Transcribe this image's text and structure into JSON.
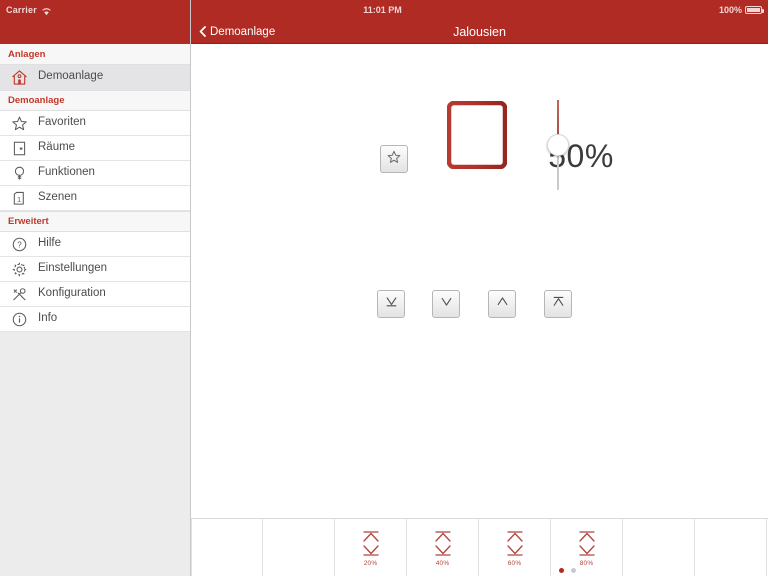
{
  "status_bar": {
    "carrier": "Carrier",
    "wifi_icon": "wifi-icon",
    "time": "11:01 PM",
    "battery_percent": "100%",
    "battery_icon": "battery-full-icon"
  },
  "navbar": {
    "back_icon": "chevron-left-icon",
    "back_label": "Demoanlage",
    "title": "Jalousien"
  },
  "sidebar": {
    "sections": [
      {
        "header": "Anlagen",
        "items": [
          {
            "label": "Demoanlage",
            "icon": "home-icon",
            "selected": true
          }
        ]
      },
      {
        "header": "Demoanlage",
        "items": [
          {
            "label": "Favoriten",
            "icon": "star-icon",
            "selected": false
          },
          {
            "label": "Räume",
            "icon": "door-icon",
            "selected": false
          },
          {
            "label": "Funktionen",
            "icon": "bulb-icon",
            "selected": false
          },
          {
            "label": "Szenen",
            "icon": "scene-icon",
            "selected": false
          }
        ]
      },
      {
        "header": "Erweitert",
        "items": [
          {
            "label": "Hilfe",
            "icon": "question-circle-icon",
            "selected": false
          },
          {
            "label": "Einstellungen",
            "icon": "gear-icon",
            "selected": false
          },
          {
            "label": "Konfiguration",
            "icon": "wrench-icon",
            "selected": false
          },
          {
            "label": "Info",
            "icon": "info-circle-icon",
            "selected": false
          }
        ]
      }
    ]
  },
  "main": {
    "favorite_button_icon": "star-icon",
    "position_percent": "50%",
    "device_icon": "blinds-icon",
    "slider": {
      "value": 50,
      "min": 0,
      "max": 100,
      "knob_icon": "slider-knob"
    },
    "controls": [
      {
        "name": "close-full-button",
        "icon": "down-bar-icon",
        "glyph": "↓"
      },
      {
        "name": "close-step-button",
        "icon": "down-icon",
        "glyph": "∨"
      },
      {
        "name": "open-step-button",
        "icon": "up-icon",
        "glyph": "∧"
      },
      {
        "name": "open-full-button",
        "icon": "up-bar-icon",
        "glyph": "↑"
      }
    ]
  },
  "toolbar": {
    "cells": [
      {
        "label": "",
        "icon": "",
        "has_preset": false
      },
      {
        "label": "",
        "icon": "",
        "has_preset": false
      },
      {
        "label": "20%",
        "icon": "preset-icon",
        "has_preset": true
      },
      {
        "label": "40%",
        "icon": "preset-icon",
        "has_preset": true
      },
      {
        "label": "60%",
        "icon": "preset-icon",
        "has_preset": true
      },
      {
        "label": "80%",
        "icon": "preset-icon",
        "has_preset": true
      },
      {
        "label": "",
        "icon": "",
        "has_preset": false
      },
      {
        "label": "",
        "icon": "",
        "has_preset": false
      }
    ],
    "page_dots": [
      true,
      false
    ]
  },
  "colors": {
    "brand_red": "#b02b24",
    "accent_red": "#c0392b",
    "sidebar_bg": "#ececed",
    "text_dark": "#4c4c4e"
  }
}
